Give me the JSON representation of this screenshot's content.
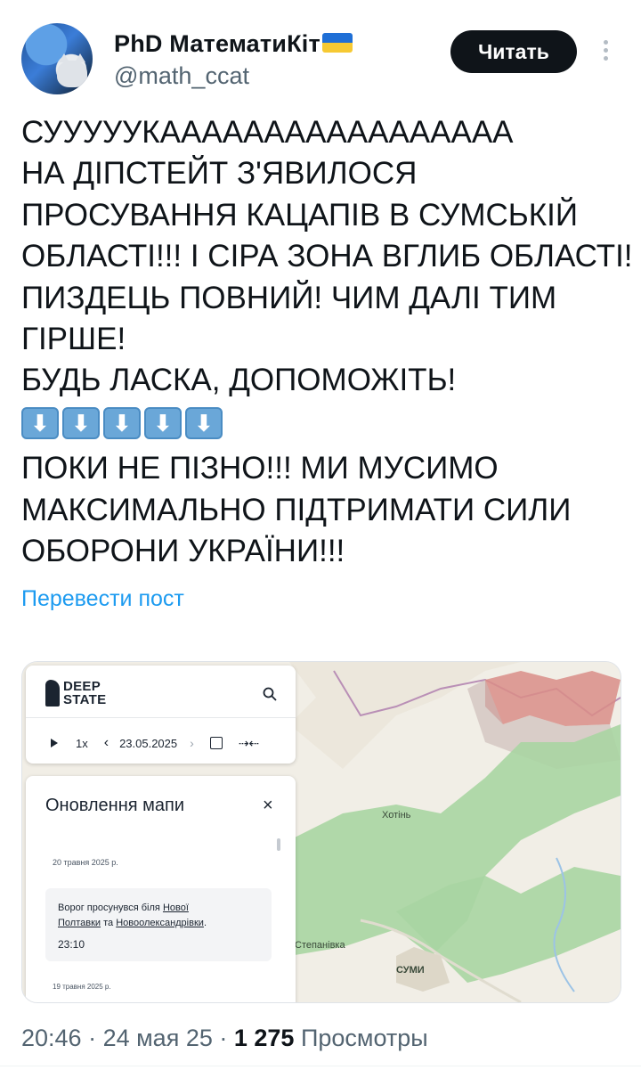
{
  "author": {
    "display_name": "PhD МатематиКіт",
    "handle": "@math_ccat",
    "flag_icon": "ukraine-flag-icon"
  },
  "header": {
    "follow_button": "Читать",
    "more_icon": "more-vertical-icon"
  },
  "tweet": {
    "lines": [
      "СУУУУУКААААААААААААААААА",
      "НА ДІПСТЕЙТ З'ЯВИЛОСЯ",
      "ПРОСУВАННЯ КАЦАПІВ В СУМСЬКІЙ",
      "ОБЛАСТІ!!! І СІРА ЗОНА ВГЛИБ ОБЛАСТІ!",
      "ПИЗДЕЦЬ ПОВНИЙ! ЧИМ ДАЛІ ТИМ",
      "ГІРШЕ!",
      "БУДЬ ЛАСКА, ДОПОМОЖІТЬ!"
    ],
    "arrow_emoji": [
      "⬇",
      "⬇",
      "⬇",
      "⬇",
      "⬇",
      "⬇"
    ],
    "lines_after": [
      "ПОКИ НЕ ПІЗНО!!! МИ МУСИМО",
      "МАКСИМАЛЬНО ПІДТРИМАТИ СИЛИ",
      "ОБОРОНИ УКРАЇНИ!!!"
    ],
    "translate_link": "Перевести пост"
  },
  "media": {
    "logo_line1": "DEEP",
    "logo_line2": "STATE",
    "speed": "1x",
    "date": "23.05.2025",
    "update_title": "Оновлення мапи",
    "update_close": "×",
    "date_header_1": "20 травня 2025 р.",
    "card_text_prefix": "Ворог просунувся біля ",
    "card_link_1a": "Нової",
    "card_link_1b": "Полтавки",
    "card_text_mid": " та ",
    "card_link_2": "Новоолександрівки",
    "card_text_suffix": ".",
    "card_time": "23:10",
    "date_header_2": "19 травня 2025 р.",
    "map_labels": {
      "khotin": "Хотінь",
      "stepanivka": "Степанівка",
      "sumy": "СУМИ"
    },
    "colors": {
      "liberated_green": "#a8d5a2",
      "occupied_red": "#d98d87",
      "gray_zone": "#c9b7b4"
    }
  },
  "footer": {
    "time": "20:46",
    "sep1": " · ",
    "date": "24 мая 25",
    "sep2": " · ",
    "views_count": "1 275",
    "views_label": " Просмотры"
  }
}
